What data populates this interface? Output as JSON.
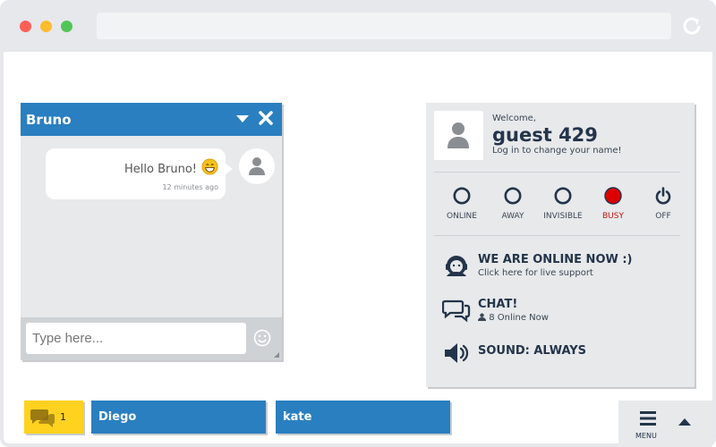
{
  "browser": {
    "url": ""
  },
  "chat_window": {
    "title": "Bruno",
    "messages": [
      {
        "text": "Hello Bruno!",
        "time": "12 minutes ago"
      }
    ],
    "input_placeholder": "Type here..."
  },
  "profile": {
    "welcome": "Welcome,",
    "name": "guest 429",
    "hint": "Log in to change your name!"
  },
  "statuses": [
    {
      "label": "ONLINE"
    },
    {
      "label": "AWAY"
    },
    {
      "label": "INVISIBLE"
    },
    {
      "label": "BUSY",
      "active": true
    },
    {
      "label": "OFF"
    }
  ],
  "panel_items": {
    "support_title": "WE ARE ONLINE NOW :)",
    "support_sub": "Click here for live support",
    "chat_title": "CHAT!",
    "chat_sub": "8 Online Now",
    "sound_title": "SOUND: ALWAYS"
  },
  "bottom_bar": {
    "unread_count": "1",
    "tabs": [
      "Diego",
      "kate"
    ],
    "menu_label": "MENU"
  },
  "colors": {
    "accent": "#2a7fc0",
    "busy": "#dd0000",
    "unread": "#ffd21f",
    "dark": "#24344a"
  }
}
